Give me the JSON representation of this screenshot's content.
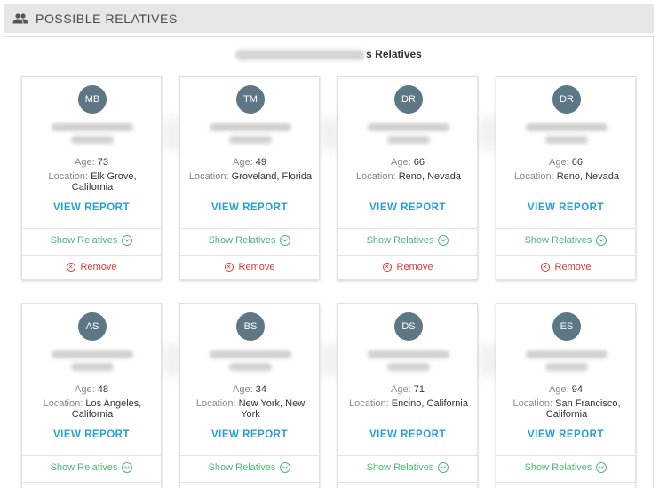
{
  "header": {
    "title": "POSSIBLE RELATIVES",
    "icon": "people-icon"
  },
  "panel": {
    "title_suffix": "s Relatives"
  },
  "labels": {
    "age": "Age:",
    "location": "Location:",
    "view_report": "VIEW REPORT",
    "show_relatives": "Show Relatives",
    "remove": "Remove"
  },
  "colors": {
    "avatar": "#5d7785",
    "link": "#2a9fd6",
    "show_relatives": "#4cb87a",
    "remove": "#d93a3a"
  },
  "cards": [
    {
      "initials": "MB",
      "age": "73",
      "location": "Elk Grove, California"
    },
    {
      "initials": "TM",
      "age": "49",
      "location": "Groveland, Florida"
    },
    {
      "initials": "DR",
      "age": "66",
      "location": "Reno, Nevada"
    },
    {
      "initials": "DR",
      "age": "66",
      "location": "Reno, Nevada"
    },
    {
      "initials": "AS",
      "age": "48",
      "location": "Los Angeles, California"
    },
    {
      "initials": "BS",
      "age": "34",
      "location": "New York, New York"
    },
    {
      "initials": "DS",
      "age": "71",
      "location": "Encino, California"
    },
    {
      "initials": "ES",
      "age": "94",
      "location": "San Francisco, California"
    }
  ]
}
